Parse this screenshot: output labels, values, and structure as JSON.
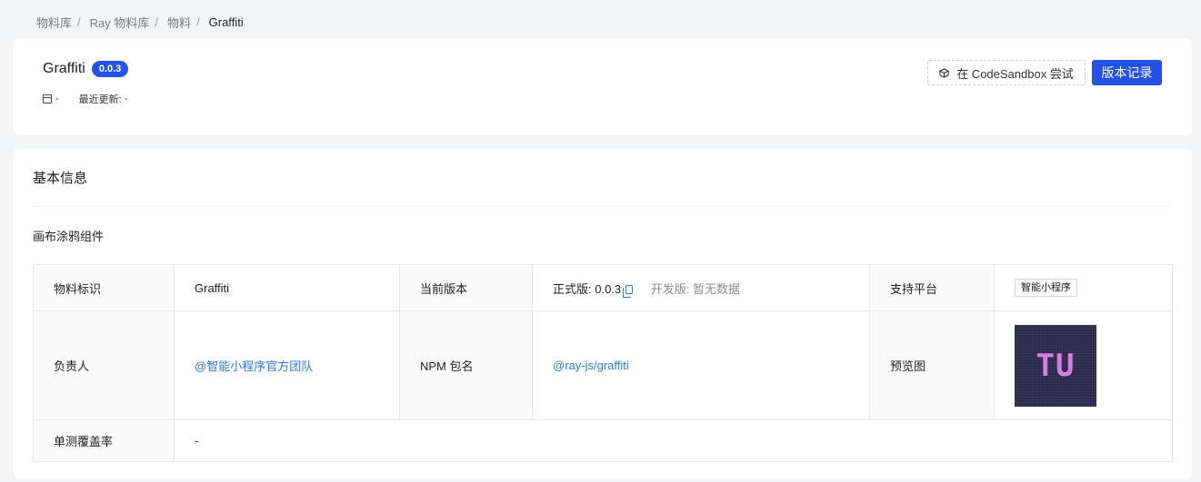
{
  "breadcrumb": [
    {
      "label": "物料库"
    },
    {
      "label": "Ray 物料库"
    },
    {
      "label": "物料"
    },
    {
      "label": "Graffiti"
    }
  ],
  "breadcrumb_separator": "/",
  "header": {
    "title": "Graffiti",
    "version": "0.0.3",
    "created": "-",
    "updated_label": "最近更新:",
    "updated_value": "-",
    "sandbox_button": "在 CodeSandbox 尝试",
    "history_button": "版本记录"
  },
  "info": {
    "section_title": "基本信息",
    "description": "画布涂鸦组件",
    "material_id_label": "物料标识",
    "material_id": "Graffiti",
    "current_version_label": "当前版本",
    "release_version": "正式版: 0.0.3",
    "dev_version": "开发版:  暂无数据",
    "platform_label": "支持平台",
    "platform": "智能小程序",
    "owner_label": "负责人",
    "owner": "@智能小程序官方团队",
    "npm_label": "NPM 包名",
    "npm": "@ray-js/graffiti",
    "preview_label": "预览图",
    "preview_text": "TU",
    "coverage_label": "单测覆盖率",
    "coverage": "-"
  },
  "colors": {
    "accent": "#2452e6",
    "link": "#2a7ae2"
  }
}
